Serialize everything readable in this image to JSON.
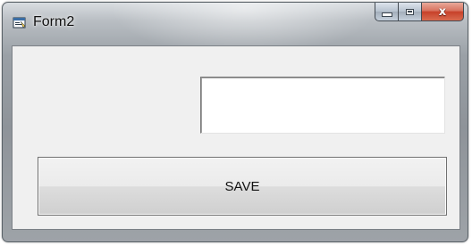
{
  "window": {
    "title": "Form2",
    "caption_buttons": {
      "minimize_icon": "minimize-icon",
      "maximize_icon": "maximize-icon",
      "close_glyph": "x"
    }
  },
  "form": {
    "text_input_value": "",
    "save_label": "SAVE"
  },
  "colors": {
    "client_background": "#f0f0f0",
    "close_button": "#c7412a"
  }
}
